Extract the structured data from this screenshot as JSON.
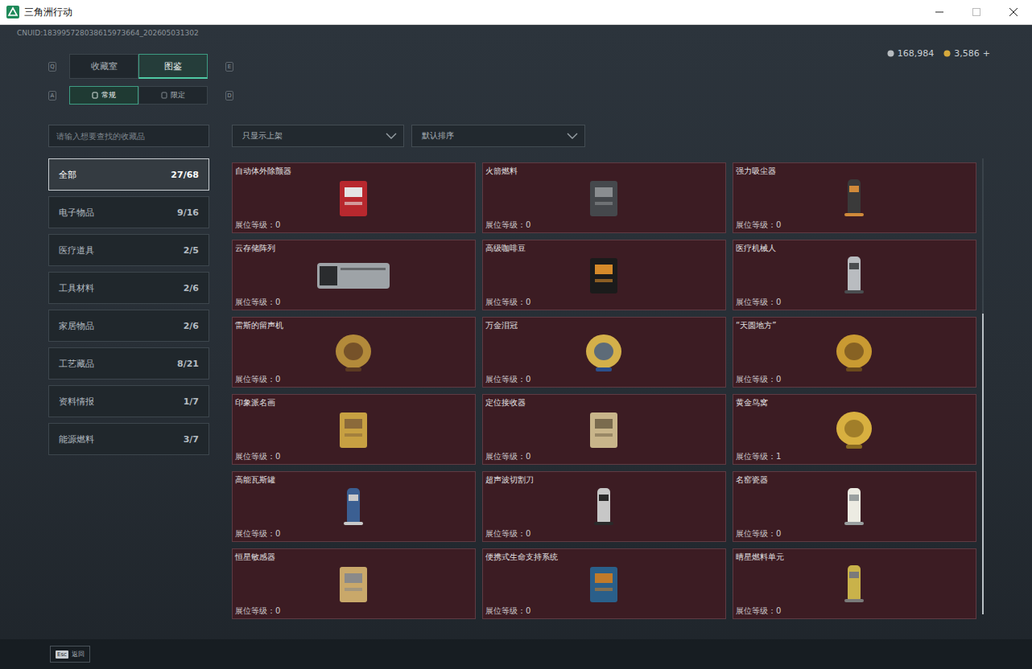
{
  "window": {
    "title": "三角洲行动"
  },
  "account": {
    "uid": "CNUID:183995728038615973664_202605031302"
  },
  "currency": [
    {
      "amount": "168,984",
      "kind": "silver",
      "add": ""
    },
    {
      "amount": "3,586",
      "kind": "gold",
      "add": "+"
    }
  ],
  "tabs": {
    "prev_key": "Q",
    "next_key": "E",
    "items": [
      {
        "label": "收藏室",
        "selected": false
      },
      {
        "label": "图鉴",
        "selected": true
      }
    ]
  },
  "sub_tabs": {
    "prev_key": "A",
    "next_key": "D",
    "items": [
      {
        "label": "常规",
        "selected": true
      },
      {
        "label": "限定",
        "selected": false
      }
    ]
  },
  "search": {
    "placeholder": "请输入想要查找的收藏品"
  },
  "filters": [
    {
      "label": "只显示上架"
    },
    {
      "label": "默认排序"
    }
  ],
  "sidebar": {
    "items": [
      {
        "label": "全部",
        "count": "27/68",
        "selected": true
      },
      {
        "label": "电子物品",
        "count": "9/16",
        "selected": false
      },
      {
        "label": "医疗道具",
        "count": "2/5",
        "selected": false
      },
      {
        "label": "工具材料",
        "count": "2/6",
        "selected": false
      },
      {
        "label": "家居物品",
        "count": "2/6",
        "selected": false
      },
      {
        "label": "工艺藏品",
        "count": "8/21",
        "selected": false
      },
      {
        "label": "资料情报",
        "count": "1/7",
        "selected": false
      },
      {
        "label": "能源燃料",
        "count": "3/7",
        "selected": false
      }
    ]
  },
  "card_level_label": "展位等级：",
  "collection": [
    {
      "name": "自动体外除颤器",
      "level": "0"
    },
    {
      "name": "火箭燃料",
      "level": "0"
    },
    {
      "name": "强力吸尘器",
      "level": "0"
    },
    {
      "name": "云存储阵列",
      "level": "0"
    },
    {
      "name": "高级咖啡豆",
      "level": "0"
    },
    {
      "name": "医疗机械人",
      "level": "0"
    },
    {
      "name": "雷斯的留声机",
      "level": "0"
    },
    {
      "name": "万金泪冠",
      "level": "0"
    },
    {
      "name": "“天圆地方”",
      "level": "0"
    },
    {
      "name": "印象派名画",
      "level": "0"
    },
    {
      "name": "定位接收器",
      "level": "0"
    },
    {
      "name": "黄金鸟窝",
      "level": "1"
    },
    {
      "name": "高能瓦斯罐",
      "level": "0"
    },
    {
      "name": "超声波切割刀",
      "level": "0"
    },
    {
      "name": "名窑瓷器",
      "level": "0"
    },
    {
      "name": "恒星敏感器",
      "level": "0"
    },
    {
      "name": "便携式生命支持系统",
      "level": "0"
    },
    {
      "name": "晴星燃料单元",
      "level": "0"
    }
  ],
  "scrollbar": {
    "offset": 0.34,
    "level": 0.66
  },
  "footer": {
    "key": "Esc",
    "label": "返回"
  }
}
